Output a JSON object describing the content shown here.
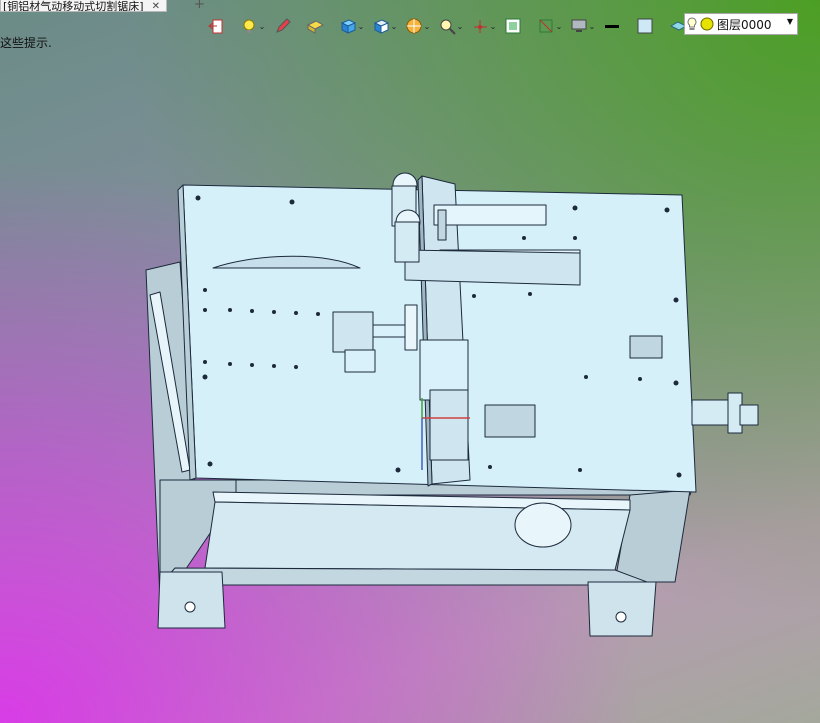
{
  "tab": {
    "title": "[铜铝材气动移动式切割锯床]",
    "close": "✕",
    "add": "+"
  },
  "hint": "这些提示.",
  "toolbar": {
    "tools": [
      {
        "icon": "exit-icon",
        "caret": false
      },
      {
        "icon": "light-icon",
        "caret": true
      },
      {
        "icon": "pen-icon",
        "caret": false
      },
      {
        "icon": "box-yellow-icon",
        "caret": false
      },
      {
        "icon": "cube-blue-icon",
        "caret": true
      },
      {
        "icon": "cube-shaded-icon",
        "caret": true
      },
      {
        "icon": "section-icon",
        "caret": true
      },
      {
        "icon": "zoom-icon",
        "caret": true
      },
      {
        "icon": "axis-icon",
        "caret": true
      },
      {
        "icon": "view-icon",
        "caret": false
      },
      {
        "icon": "frame-icon",
        "caret": true
      },
      {
        "icon": "monitor-icon",
        "caret": true
      },
      {
        "icon": "line-icon",
        "caret": false
      },
      {
        "icon": "color-icon",
        "caret": false
      },
      {
        "icon": "layer-tool-icon",
        "caret": true
      }
    ],
    "layer_label": "图层0000",
    "caret_glyph": "⌄",
    "dropdown_glyph": "▼"
  },
  "colors": {
    "model_fill": "#d9f1fb",
    "model_stroke": "#1c2a3c",
    "frame": "#b5c9d3",
    "top": "#d6f0fa"
  }
}
